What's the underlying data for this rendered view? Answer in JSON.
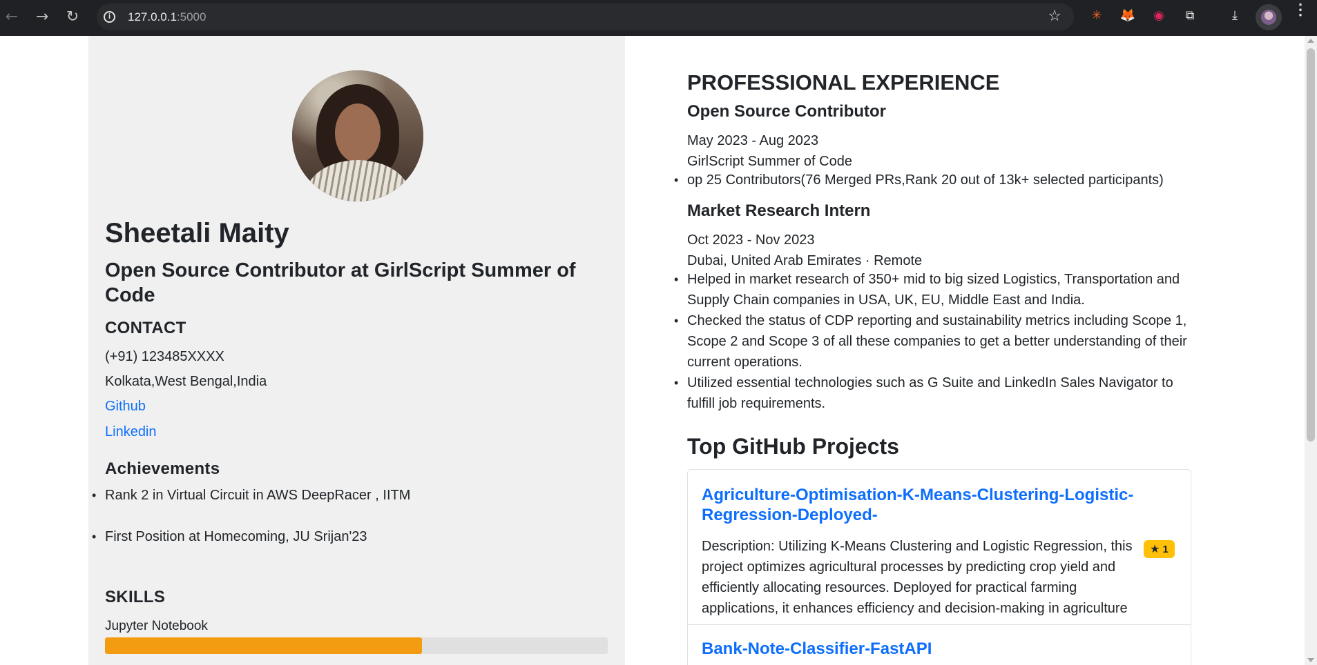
{
  "browser": {
    "url_host": "127.0.0.1",
    "url_port": ":5000",
    "back_icon": "←",
    "forward_icon": "→",
    "reload_icon": "↻",
    "info_icon": "i",
    "star_icon": "☆",
    "extensions": [
      {
        "name": "extension-1-icon",
        "glyph": "✳"
      },
      {
        "name": "metamask-icon",
        "glyph": "🦊"
      },
      {
        "name": "record-icon",
        "glyph": "◉"
      },
      {
        "name": "puzzle-icon",
        "glyph": "⧉"
      }
    ],
    "download_icon": "⤓",
    "menu_icon": "⋮"
  },
  "profile": {
    "name": "Sheetali Maity",
    "headline": "Open Source Contributor at GirlScript Summer of Code"
  },
  "contact": {
    "heading": "CONTACT",
    "phone": "(+91) 123485XXXX",
    "location": "Kolkata,West Bengal,India",
    "github_label": "Github",
    "linkedin_label": "Linkedin"
  },
  "achievements": {
    "heading": "Achievements",
    "items": [
      "Rank 2 in Virtual Circuit in AWS DeepRacer , IITM",
      "First Position at Homecoming, JU Srijan'23"
    ]
  },
  "skills": {
    "heading": "SKILLS",
    "items": [
      {
        "label": "Jupyter Notebook",
        "level": 0.63
      }
    ]
  },
  "experience": {
    "heading": "PROFESSIONAL EXPERIENCE",
    "jobs": [
      {
        "title": "Open Source Contributor",
        "dates": "May 2023 - Aug 2023",
        "org": "GirlScript Summer of Code",
        "bullets": [
          "op 25 Contributors(76 Merged PRs,Rank 20 out of 13k+ selected participants)"
        ]
      },
      {
        "title": "Market Research Intern",
        "dates": "Oct 2023 - Nov 2023",
        "org": "Dubai, United Arab Emirates · Remote",
        "bullets": [
          "Helped in market research of 350+ mid to big sized Logistics, Transportation and Supply Chain companies in USA, UK, EU, Middle East and India.",
          "Checked the status of CDP reporting and sustainability metrics including Scope 1, Scope 2 and Scope 3 of all these companies to get a better understanding of their current operations.",
          "Utilized essential technologies such as G Suite and LinkedIn Sales Navigator to fulfill job requirements."
        ]
      }
    ]
  },
  "github": {
    "heading": "Top GitHub Projects",
    "projects": [
      {
        "name": "Agriculture-Optimisation-K-Means-Clustering-Logistic-Regression-Deployed-",
        "description": "Description: Utilizing K-Means Clustering and Logistic Regression, this project optimizes agricultural processes by predicting crop yield and efficiently allocating resources. Deployed for practical farming applications, it enhances efficiency and decision-making in agriculture",
        "stars": "1",
        "star_glyph": "★"
      },
      {
        "name": "Bank-Note-Classifier-FastAPI"
      }
    ]
  },
  "colors": {
    "link": "#0d6efd",
    "skill_bar": "#f39c12",
    "badge": "#ffc107",
    "sidebar_bg": "#f0f0f0"
  }
}
